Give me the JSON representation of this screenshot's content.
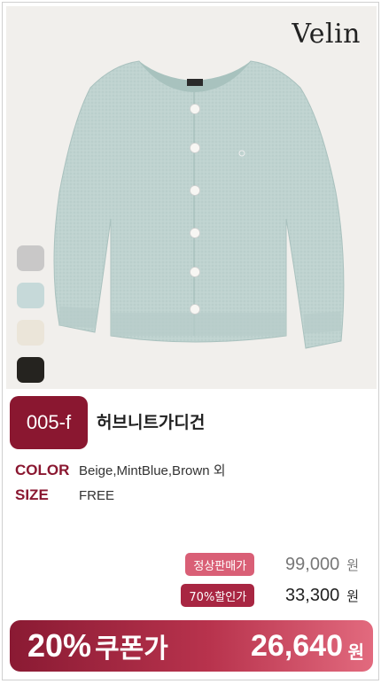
{
  "brand": {
    "logo_text": "Velin"
  },
  "product": {
    "code": "005-f",
    "name": "허브니트가디건",
    "swatches": [
      {
        "name": "Gray",
        "color": "#c9c8c8"
      },
      {
        "name": "MintBlue",
        "color": "#c6d9d9"
      },
      {
        "name": "Beige",
        "color": "#ebe5d9"
      },
      {
        "name": "Black",
        "color": "#25231f"
      }
    ],
    "garment_color": "#bfd3d0"
  },
  "specs": {
    "color_label": "COLOR",
    "color_value": "Beige,MintBlue,Brown 외",
    "size_label": "SIZE",
    "size_value": "FREE"
  },
  "pricing": {
    "regular_label": "정상판매가",
    "regular_price": "99,000",
    "regular_unit": "원",
    "discount_label": "70%할인가",
    "discount_price": "33,300",
    "discount_unit": "원",
    "coupon_percent": "20%",
    "coupon_label": "쿠폰가",
    "coupon_price": "26,640",
    "coupon_unit": "원"
  },
  "colors": {
    "accent": "#8a1730",
    "regular_tag": "#d95f76",
    "discount_tag": "#a82642"
  }
}
